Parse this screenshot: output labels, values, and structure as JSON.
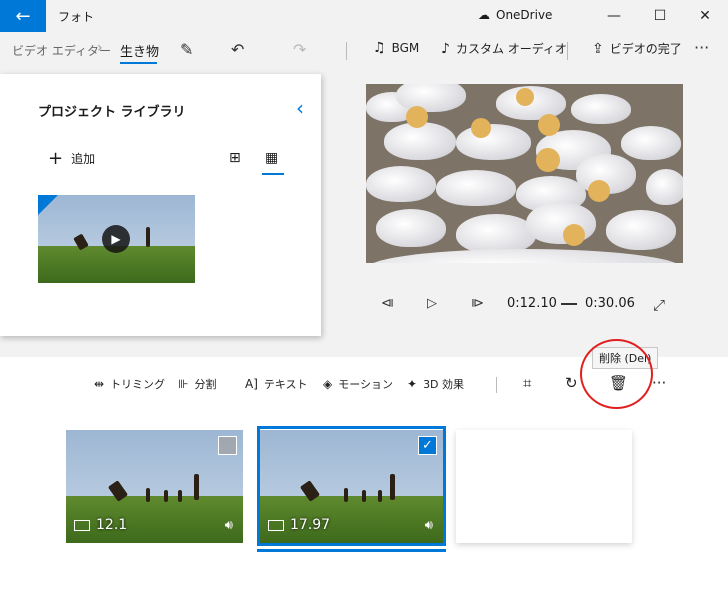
{
  "titlebar": {
    "app_title": "フォト",
    "onedrive_label": "OneDrive"
  },
  "toolbar": {
    "breadcrumb_root": "ビデオ エディター",
    "breadcrumb_current": "生き物",
    "bgm_label": "BGM",
    "custom_audio_label": "カスタム オーディオ",
    "finish_video_label": "ビデオの完了"
  },
  "library": {
    "title": "プロジェクト ライブラリ",
    "add_label": "追加"
  },
  "player": {
    "current_time": "0:12.10",
    "total_time": "0:30.06"
  },
  "storyboard_tools": {
    "trim": "トリミング",
    "split": "分割",
    "text": "テキスト",
    "motion": "モーション",
    "effects_3d": "3D 効果",
    "delete_tooltip": "削除 (Del)"
  },
  "clips": [
    {
      "duration": "12.1",
      "selected": false
    },
    {
      "duration": "17.97",
      "selected": true
    }
  ]
}
